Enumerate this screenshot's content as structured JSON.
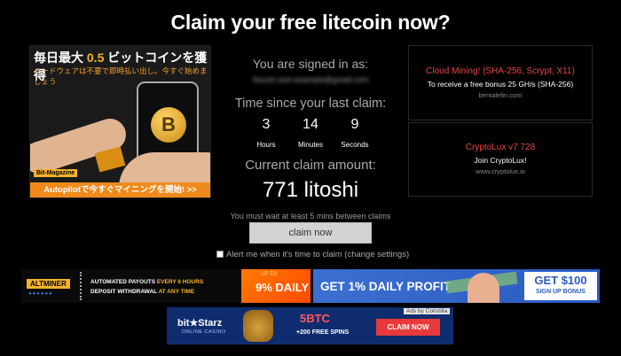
{
  "title": "Claim your free litecoin now?",
  "ad_left": {
    "headline_prefix": "毎日最大",
    "headline_value": "0.5",
    "headline_suffix": "ビットコインを獲得",
    "subline": "ハードウェアは不要で即時払い出し。今すぐ始めましょう",
    "brand": "Bit-Magazine",
    "cta": "Autopilotで今すぐマイニングを開始! >>",
    "coin_symbol": "B"
  },
  "session": {
    "signed_in_label": "You are signed in as:",
    "email": "faucet.user.example@gmail.com",
    "time_since_label": "Time since your last claim:",
    "timer": [
      {
        "value": "3",
        "unit": "Hours"
      },
      {
        "value": "14",
        "unit": "Minutes"
      },
      {
        "value": "9",
        "unit": "Seconds"
      }
    ],
    "current_amount_label": "Current claim amount:",
    "current_amount": "771 litoshi",
    "wait_notice": "You must wait at least 5 mins between claims"
  },
  "claim": {
    "button_label": "claim now",
    "alert_text": "Alert me when it's time to claim (",
    "alert_link": "change settings",
    "alert_close": ")",
    "alert_checked": false
  },
  "ads_right": [
    {
      "title": "Cloud Mining! (SHA-256, Scrypt, X11)",
      "desc": "To receive a free bonus 25 GH/s (SHA-256)",
      "url": "bentalefin.com"
    },
    {
      "title": "CryptoLux v7 728",
      "desc": "Join CryptoLux!",
      "url": "www.cryptolux.io"
    }
  ],
  "banner_altminer": {
    "logo": "ALTMINER",
    "line1_a": "AUTOMATED PAYOUTS ",
    "line1_b": "EVERY 6 HOURS",
    "line2_a": "DEPOSIT WITHDRAWAL ",
    "line2_b": "AT ANY TIME",
    "upto": "UP TO",
    "daily": "9% DAILY"
  },
  "banner_profit": {
    "headline": "GET 1% DAILY PROFIT",
    "amount": "GET $100",
    "bonus": "SIGN UP BONUS"
  },
  "banner_bitstarz": {
    "logo": "bit★Starz",
    "sub": "ONLINE CASINO",
    "btc": "5BTC",
    "spins": "+200 FREE SPINS",
    "cta": "CLAIM NOW"
  },
  "ads_by": "Ads by Coinzilla",
  "colors": {
    "background": "#000000",
    "ad_title": "#e64646",
    "accent_gold": "#f5b32b",
    "orange": "#f08a1c",
    "profit_blue": "#3b6fd0",
    "bitstarz_blue": "#0f2c6e"
  }
}
